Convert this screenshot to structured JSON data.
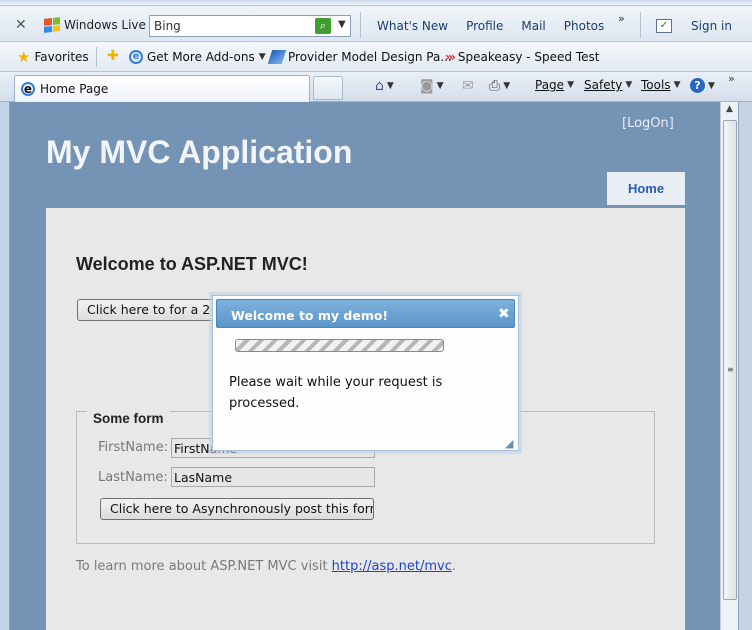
{
  "live_toolbar": {
    "brand": "Windows Live",
    "search_value": "Bing",
    "links": [
      "What's New",
      "Profile",
      "Mail",
      "Photos"
    ],
    "more": "»",
    "signin": "Sign in"
  },
  "favorites_bar": {
    "favorites_label": "Favorites",
    "items": [
      "Get More Add-ons",
      "Provider Model Design Pa...",
      "Speakeasy - Speed Test"
    ]
  },
  "tab_bar": {
    "tab_title": "Home Page",
    "commands": [
      "Page",
      "Safety",
      "Tools"
    ]
  },
  "site": {
    "logon": "[LogOn]",
    "title": "My MVC Application",
    "menu_home": "Home",
    "welcome": "Welcome to ASP.NET MVC!",
    "demo_button": "Click here to for a 2 second demo",
    "form_legend": "Some form",
    "firstname_label": "FirstName:",
    "firstname_value": "FirstName",
    "lastname_label": "LastName:",
    "lastname_value": "LasName",
    "submit_button": "Click here to Asynchronously post this form",
    "learn_text": "To learn more about ASP.NET MVC visit ",
    "learn_link": "http://asp.net/mvc",
    "learn_end": "."
  },
  "dialog": {
    "title": "Welcome to my demo!",
    "close": "✖",
    "message": "Please wait while your request is processed."
  }
}
